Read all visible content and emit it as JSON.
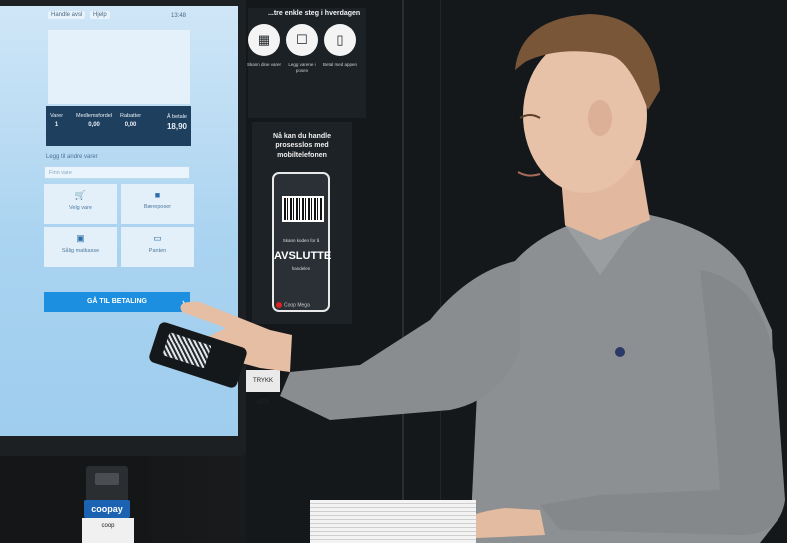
{
  "kiosk": {
    "status_tabs": [
      "Handle avsl",
      "Hjelp"
    ],
    "status_time": "13:48",
    "summary": {
      "items_label": "Varer",
      "items_value": "1",
      "membership_label": "Medlemsfordel",
      "membership_value": "0,00",
      "discount_label": "Rabatter",
      "discount_value": "0,00",
      "topay_label": "Å betale",
      "topay_value": "18,90"
    },
    "add_label": "Legg til andre varer",
    "search_placeholder": "Finn vare",
    "tiles": [
      {
        "label": "Velg vare",
        "icon": "cart-icon"
      },
      {
        "label": "Bæreposer",
        "icon": "bag-icon"
      },
      {
        "label": "Sålig matkasse",
        "icon": "basket-icon"
      },
      {
        "label": "Panten",
        "icon": "bottle-icon"
      }
    ],
    "pay_button": "GÅ TIL BETALING"
  },
  "posters": {
    "top_title": "...tre enkle steg i hverdagen",
    "steps": [
      {
        "icon": "scan-icon",
        "caption": "Skann dine varer"
      },
      {
        "icon": "bag-icon",
        "caption": "Legg varene i posen"
      },
      {
        "icon": "phone-icon",
        "caption": "Betal med appen"
      }
    ],
    "main_headline": "Nå kan du handle prosesslos med mobiltelefonen",
    "phone_small_top": "Skann koden for å",
    "phone_big": "AVSLUTTE",
    "phone_small_bottom": "handelen",
    "logo_text": "Coop Mega",
    "small_label": "TRYKK HER"
  },
  "base": {
    "badge": "coopay",
    "sticker": "coop"
  },
  "colors": {
    "screen": "#a9d3f0",
    "pay_button": "#1d8fe0",
    "summary_bar": "#1f3f5f",
    "shirt": "#8c8f91",
    "coopay": "#1b62b2"
  }
}
